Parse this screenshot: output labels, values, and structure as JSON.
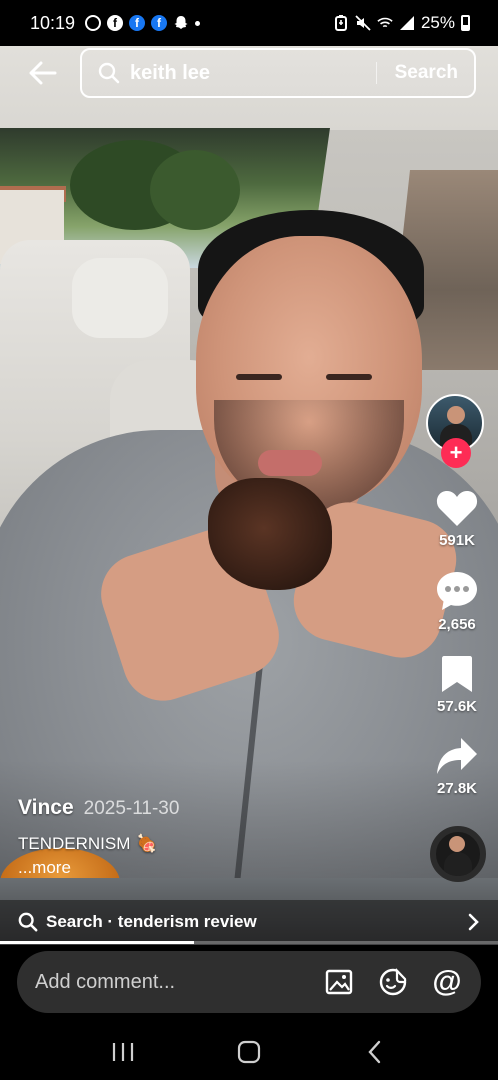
{
  "status_bar": {
    "time": "10:19",
    "battery": "25%",
    "icons": [
      "chrome-icon",
      "facebook-icon",
      "facebook-icon",
      "facebook-icon",
      "snapchat-icon",
      "dot-icon",
      "battery-saver-icon",
      "mute-icon",
      "wifi-icon",
      "signal-icon",
      "battery-icon"
    ]
  },
  "header": {
    "search_query": "keith lee",
    "search_button": "Search"
  },
  "actions": {
    "likes": "591K",
    "comments": "2,656",
    "saves": "57.6K",
    "shares": "27.8K",
    "follow_symbol": "+"
  },
  "caption": {
    "author": "Vince",
    "date": "2025-11-30",
    "text": "TENDERNISM",
    "emoji": "🍖",
    "more": "...more"
  },
  "suggestion": {
    "label": "Search · tenderism review"
  },
  "playback": {
    "progress": 0.39
  },
  "comment_bar": {
    "placeholder": "Add comment..."
  },
  "colors": {
    "accent": "#fe2c55",
    "background": "#000000",
    "comment_input": "#2f2f2f"
  }
}
